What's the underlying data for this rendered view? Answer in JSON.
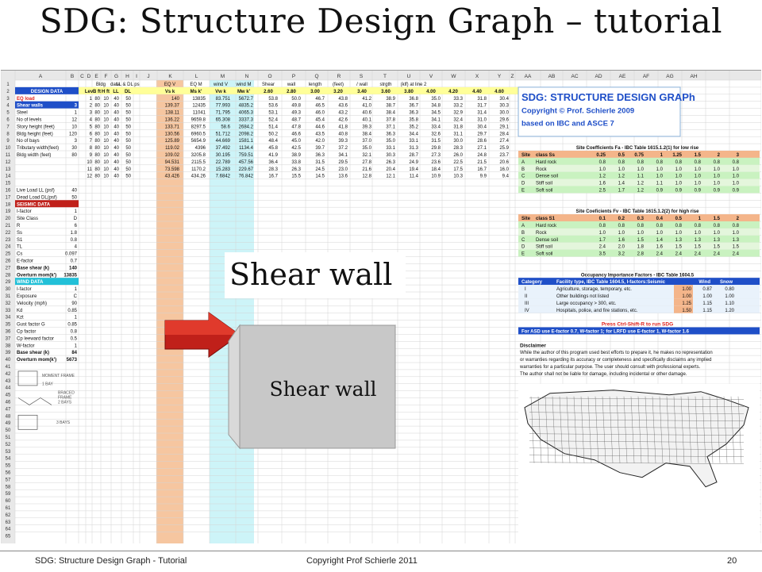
{
  "slide": {
    "title": "SDG: Structure Design Graph – tutorial",
    "callout": "Shear wall",
    "box_label": "Shear wall"
  },
  "footer": {
    "left": "SDG: Structure Design Graph - Tutorial",
    "center": "Copyright Prof Schierle 2011",
    "page": "20"
  },
  "colors": {
    "salmon": "#f6c6a0",
    "cyan": "#cdf4f8",
    "blue": "#1f4fc8",
    "red": "#e0201a",
    "green": "#c9f2c0",
    "yellow": "#ffff99",
    "orange_band": "#f4b58a"
  },
  "sheet": {
    "columns": [
      "A",
      "B",
      "C",
      "D",
      "E",
      "F",
      "G",
      "H",
      "I",
      "J",
      "K",
      "L",
      "M",
      "N",
      "O",
      "P",
      "Q",
      "R",
      "S",
      "T",
      "U",
      "V",
      "W",
      "X",
      "Y",
      "Z",
      "AA",
      "AB",
      "AC",
      "AD",
      "AE",
      "AF",
      "AG",
      "AH"
    ],
    "header1": [
      "Bldg",
      "data",
      "LL & DL ps",
      "EQ V",
      "EQ M",
      "wind V",
      "wind M",
      "Shear",
      "wall",
      "length",
      "(feet)",
      "/ wall",
      "strgth",
      "(klf) at line 2"
    ],
    "header2": [
      "Lev",
      "B ft",
      "H ft",
      "LL",
      "DL",
      "Vs k",
      "Ms k'",
      "Vw k",
      "Mw k'",
      "2.60",
      "2.80",
      "3.00",
      "3.20",
      "3.40",
      "3.60",
      "3.80",
      "4.00",
      "4.20",
      "4.40",
      "4.60"
    ],
    "left_items": [
      {
        "label": "DESIGN DATA",
        "value": "",
        "style": "blue"
      },
      {
        "label": "EQ load",
        "value": "",
        "style": "red"
      },
      {
        "label": "Shear walls",
        "value": "3",
        "style": "blue"
      },
      {
        "label": "Steel",
        "value": "1",
        "style": ""
      },
      {
        "label": "No of levels",
        "value": "12",
        "style": ""
      },
      {
        "label": "Story height (feet)",
        "value": "10",
        "style": ""
      },
      {
        "label": "Bldg height (feet)",
        "value": "120",
        "style": ""
      },
      {
        "label": "No of bays",
        "value": "3",
        "style": ""
      },
      {
        "label": "Tributary width(feet)",
        "value": "30",
        "style": ""
      },
      {
        "label": "Bldg width (feet)",
        "value": "80",
        "style": ""
      },
      {
        "label": "",
        "value": "",
        "style": ""
      },
      {
        "label": "",
        "value": "",
        "style": ""
      },
      {
        "label": "",
        "value": "",
        "style": ""
      },
      {
        "label": "",
        "value": "",
        "style": ""
      },
      {
        "label": "Live Load LL (psf)",
        "value": "40",
        "style": ""
      },
      {
        "label": "Dead Load DL(psf)",
        "value": "50",
        "style": ""
      },
      {
        "label": "SEISMIC DATA",
        "value": "",
        "style": "redhead"
      },
      {
        "label": "I-factor",
        "value": "1",
        "style": ""
      },
      {
        "label": "Site Class",
        "value": "D",
        "style": ""
      },
      {
        "label": "R",
        "value": "6",
        "style": ""
      },
      {
        "label": "Ss",
        "value": "1.8",
        "style": ""
      },
      {
        "label": "S1",
        "value": "0.8",
        "style": ""
      },
      {
        "label": "TL",
        "value": "4",
        "style": ""
      },
      {
        "label": "Cs",
        "value": "0.097",
        "style": ""
      },
      {
        "label": "E-factor",
        "value": "0.7",
        "style": ""
      },
      {
        "label": "Base shear (k)",
        "value": "140",
        "style": "bold"
      },
      {
        "label": "Overturn mom(k')",
        "value": "13835",
        "style": "bold"
      },
      {
        "label": "WIND DATA",
        "value": "",
        "style": "cyanhead"
      },
      {
        "label": "I-factor",
        "value": "1",
        "style": ""
      },
      {
        "label": "Exposure",
        "value": "C",
        "style": ""
      },
      {
        "label": "Velocity (mph)",
        "value": "90",
        "style": ""
      },
      {
        "label": "Kd",
        "value": "0.85",
        "style": ""
      },
      {
        "label": "Kzt",
        "value": "1",
        "style": ""
      },
      {
        "label": "Gust factor G",
        "value": "0.85",
        "style": ""
      },
      {
        "label": "Cp factor",
        "value": "0.8",
        "style": ""
      },
      {
        "label": "Cp leeward factor",
        "value": "0.5",
        "style": ""
      },
      {
        "label": "W-factor",
        "value": "1",
        "style": ""
      },
      {
        "label": "Base shear (k)",
        "value": "84",
        "style": "bold"
      },
      {
        "label": "Overturn mom(k')",
        "value": "5673",
        "style": "bold"
      }
    ],
    "data_rows": [
      [
        "1",
        "80",
        "10",
        "40",
        "50",
        "140",
        "13835",
        "83.751",
        "5672.7",
        "53.8",
        "50.0",
        "46.7",
        "43.8",
        "41.2",
        "38.9",
        "36.8",
        "35.0",
        "33.3",
        "31.8",
        "30.4"
      ],
      [
        "2",
        "80",
        "10",
        "40",
        "50",
        "139.37",
        "12435",
        "77.993",
        "4835.2",
        "53.6",
        "49.8",
        "46.5",
        "43.6",
        "41.0",
        "38.7",
        "36.7",
        "34.8",
        "33.2",
        "31.7",
        "30.3"
      ],
      [
        "3",
        "80",
        "10",
        "40",
        "50",
        "138.11",
        "11041",
        "71.795",
        "4065.3",
        "53.1",
        "49.3",
        "46.0",
        "43.2",
        "40.6",
        "38.4",
        "36.3",
        "34.5",
        "32.9",
        "31.4",
        "30.0"
      ],
      [
        "4",
        "80",
        "10",
        "40",
        "50",
        "136.22",
        "9659.8",
        "65.308",
        "3337.3",
        "52.4",
        "48.7",
        "45.4",
        "42.6",
        "40.1",
        "37.8",
        "35.8",
        "34.1",
        "32.4",
        "31.0",
        "29.6"
      ],
      [
        "5",
        "80",
        "10",
        "40",
        "50",
        "133.71",
        "8297.5",
        "58.6",
        "2684.2",
        "51.4",
        "47.8",
        "44.6",
        "41.8",
        "39.3",
        "37.1",
        "35.2",
        "33.4",
        "31.8",
        "30.4",
        "29.1"
      ],
      [
        "6",
        "80",
        "10",
        "40",
        "50",
        "130.56",
        "6960.5",
        "51.712",
        "2098.2",
        "50.2",
        "46.6",
        "43.5",
        "40.8",
        "38.4",
        "36.3",
        "34.4",
        "32.6",
        "31.1",
        "29.7",
        "28.4"
      ],
      [
        "7",
        "80",
        "10",
        "40",
        "50",
        "125.89",
        "5654.9",
        "44.669",
        "1581.1",
        "48.4",
        "45.0",
        "42.0",
        "39.3",
        "37.0",
        "35.0",
        "33.1",
        "31.5",
        "30.0",
        "28.6",
        "27.4"
      ],
      [
        "8",
        "80",
        "10",
        "40",
        "50",
        "119.02",
        "4396",
        "37.492",
        "1134.4",
        "45.8",
        "42.5",
        "39.7",
        "37.2",
        "35.0",
        "33.1",
        "31.3",
        "29.8",
        "28.3",
        "27.1",
        "25.9"
      ],
      [
        "9",
        "80",
        "10",
        "40",
        "50",
        "109.02",
        "3205.8",
        "30.195",
        "759.51",
        "41.9",
        "38.9",
        "36.3",
        "34.1",
        "32.1",
        "30.3",
        "28.7",
        "27.3",
        "26.0",
        "24.8",
        "23.7"
      ],
      [
        "10",
        "80",
        "10",
        "40",
        "50",
        "94.531",
        "2115.5",
        "22.789",
        "457.56",
        "36.4",
        "33.8",
        "31.5",
        "29.5",
        "27.8",
        "26.3",
        "24.9",
        "23.6",
        "22.5",
        "21.5",
        "20.6"
      ],
      [
        "11",
        "80",
        "10",
        "40",
        "50",
        "73.598",
        "1170.2",
        "15.283",
        "229.67",
        "28.3",
        "26.3",
        "24.5",
        "23.0",
        "21.6",
        "20.4",
        "19.4",
        "18.4",
        "17.5",
        "16.7",
        "16.0"
      ],
      [
        "12",
        "80",
        "10",
        "40",
        "50",
        "43.426",
        "434.26",
        "7.6842",
        "76.842",
        "16.7",
        "15.5",
        "14.5",
        "13.6",
        "12.8",
        "12.1",
        "11.4",
        "10.9",
        "10.3",
        "9.9",
        "9.4"
      ]
    ],
    "sdg_box": {
      "title": "SDG: STRUCTURE DESIGN GRAPh",
      "copyright": "Copyright © Prof. Schierle 2009",
      "basis": "based on IBC and ASCE 7"
    },
    "fa_table": {
      "title": "Site Coefficients Fa - IBC Table 1615.1.2(1) for low rise",
      "header": [
        "Site",
        "class Ss",
        "0.25",
        "0.5",
        "0.75",
        "1",
        "1.25",
        "1.5",
        "2",
        "3"
      ],
      "rows": [
        [
          "A",
          "Hard rock",
          "0.8",
          "0.8",
          "0.8",
          "0.8",
          "0.8",
          "0.8",
          "0.8",
          "0.8"
        ],
        [
          "B",
          "Rock",
          "1.0",
          "1.0",
          "1.0",
          "1.0",
          "1.0",
          "1.0",
          "1.0",
          "1.0"
        ],
        [
          "C",
          "Dense soil",
          "1.2",
          "1.2",
          "1.1",
          "1.0",
          "1.0",
          "1.0",
          "1.0",
          "1.0"
        ],
        [
          "D",
          "Stiff soil",
          "1.6",
          "1.4",
          "1.2",
          "1.1",
          "1.0",
          "1.0",
          "1.0",
          "1.0"
        ],
        [
          "E",
          "Soft soil",
          "2.5",
          "1.7",
          "1.2",
          "0.9",
          "0.9",
          "0.9",
          "0.9",
          "0.9"
        ]
      ]
    },
    "fv_table": {
      "title": "Site Coeficients Fv - IBC Table 1615.1.2(2) for high rise",
      "header": [
        "Site",
        "class S1",
        "0.1",
        "0.2",
        "0.3",
        "0.4",
        "0.5",
        "1",
        "1.5",
        "2"
      ],
      "rows": [
        [
          "A",
          "Hard rock",
          "0.8",
          "0.8",
          "0.8",
          "0.8",
          "0.8",
          "0.8",
          "0.8",
          "0.8"
        ],
        [
          "B",
          "Rock",
          "1.0",
          "1.0",
          "1.0",
          "1.0",
          "1.0",
          "1.0",
          "1.0",
          "1.0"
        ],
        [
          "C",
          "Dense soil",
          "1.7",
          "1.6",
          "1.5",
          "1.4",
          "1.3",
          "1.3",
          "1.3",
          "1.3"
        ],
        [
          "D",
          "Stiff soil",
          "2.4",
          "2.0",
          "1.8",
          "1.6",
          "1.5",
          "1.5",
          "1.5",
          "1.5"
        ],
        [
          "E",
          "Soft soil",
          "3.5",
          "3.2",
          "2.8",
          "2.4",
          "2.4",
          "2.4",
          "2.4",
          "2.4"
        ]
      ]
    },
    "occ_table": {
      "title": "Occupancy Importance Factors - IBC Table 1604.5",
      "header": [
        "Category",
        "Facility type, IBC Table 1604.5, I-factors:Seismic",
        "Wind",
        "Snow"
      ],
      "rows": [
        [
          "I",
          "Agriculture, storage, temporary, etc.",
          "1.00",
          "0.87",
          "0.80"
        ],
        [
          "II",
          "Other buildings not listed",
          "1.00",
          "1.00",
          "1.00"
        ],
        [
          "III",
          "Large occupancy > 300, etc.",
          "1.25",
          "1.15",
          "1.10"
        ],
        [
          "IV",
          "Hospitals, police, and fire stations, etc.",
          "1.50",
          "1.15",
          "1.20"
        ]
      ]
    },
    "run_note": "Press Ctrl-Shift-R to run SDG",
    "asd_note": "For ASD use E-factor 0.7, W-factor 1; for LRFD use E-factor 1, W-factor 1.6",
    "disclaimer": {
      "title": "Disclaimer",
      "lines": [
        "While the author of this program used best efforts to prepare it, he makes no representation",
        "or warranties regarding its accuracy or completeness and specifically disclaims any implied",
        "warranties for a particular purpose. The user should consult with professional experts.",
        "The author shall not be liable for damage, including incidental or other damage."
      ]
    },
    "frame_labels": {
      "moment": [
        "MOMENT FRAME",
        "1 BAY"
      ],
      "braced": [
        "BRACED",
        "FRAME",
        "2 BAYS"
      ],
      "bays3": [
        "3 BAYS"
      ]
    }
  }
}
